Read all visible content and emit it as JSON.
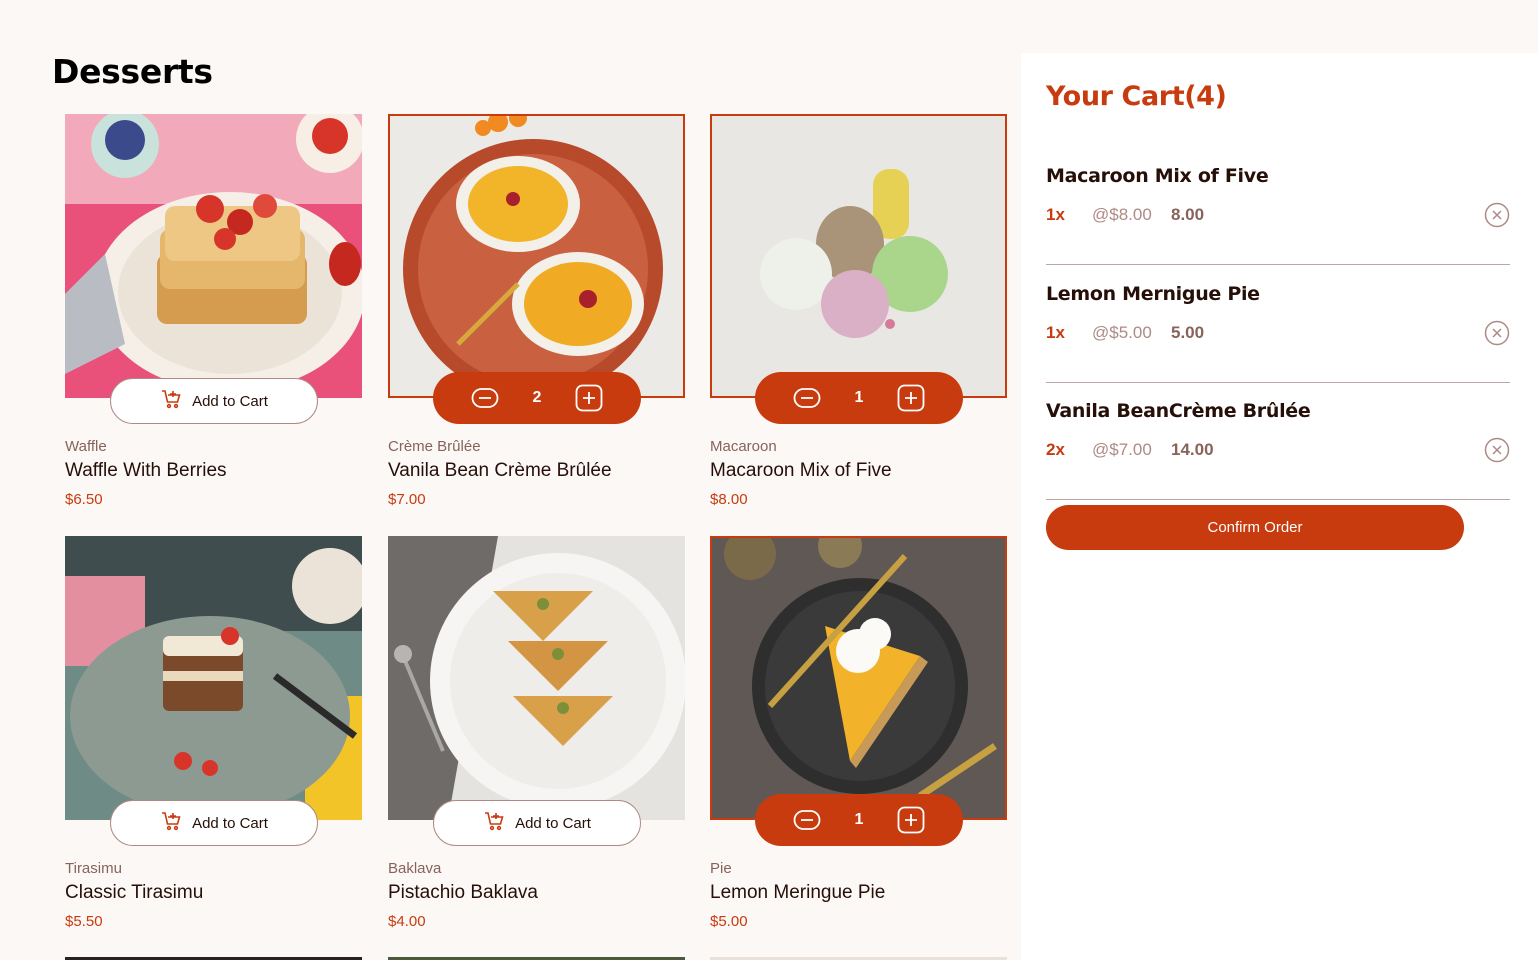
{
  "page": {
    "title": "Desserts"
  },
  "products": [
    {
      "category": "Waffle",
      "name": "Waffle With Berries",
      "price": "$6.50",
      "in_cart": false,
      "add_label": "Add to Cart"
    },
    {
      "category": "Crème Brûlée",
      "name": "Vanila Bean Crème Brûlée",
      "price": "$7.00",
      "in_cart": true,
      "quantity": "2"
    },
    {
      "category": "Macaroon",
      "name": "Macaroon Mix of Five",
      "price": "$8.00",
      "in_cart": true,
      "quantity": "1"
    },
    {
      "category": "Tirasimu",
      "name": "Classic Tirasimu",
      "price": "$5.50",
      "in_cart": false,
      "add_label": "Add to Cart"
    },
    {
      "category": "Baklava",
      "name": "Pistachio Baklava",
      "price": "$4.00",
      "in_cart": false,
      "add_label": "Add to Cart"
    },
    {
      "category": "Pie",
      "name": "Lemon Meringue Pie",
      "price": "$5.00",
      "in_cart": true,
      "quantity": "1"
    }
  ],
  "cart": {
    "title": "Your Cart(4)",
    "items": [
      {
        "name": "Macaroon Mix of Five",
        "qty": "1x",
        "unit_price": "@$8.00",
        "total": "8.00"
      },
      {
        "name": "Lemon Mernigue Pie",
        "qty": "1x",
        "unit_price": "@$5.00",
        "total": "5.00"
      },
      {
        "name": "Vanila BeanCrème Brûlée",
        "qty": "2x",
        "unit_price": "@$7.00",
        "total": "14.00"
      }
    ],
    "confirm_label": "Confirm Order"
  },
  "colors": {
    "accent": "#c73b0f",
    "text": "#260f08",
    "muted": "#87635a",
    "background": "#fcf8f6"
  }
}
